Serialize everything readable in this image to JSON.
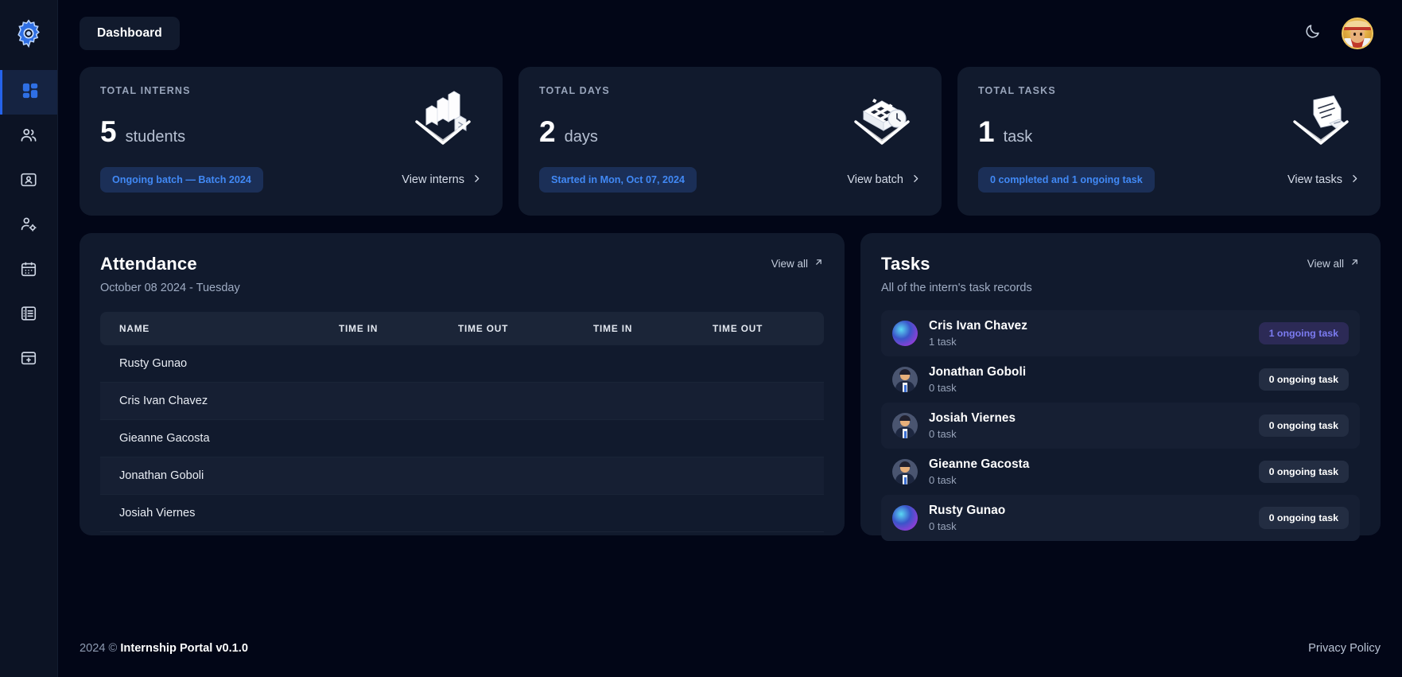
{
  "brand": {
    "icon": "gear-logo-icon"
  },
  "sidebar": {
    "items": [
      {
        "icon": "dashboard-grid-icon",
        "name": "dashboard",
        "active": true
      },
      {
        "icon": "users-icon",
        "name": "interns",
        "active": false
      },
      {
        "icon": "id-card-icon",
        "name": "profiles",
        "active": false
      },
      {
        "icon": "user-settings-icon",
        "name": "user-settings",
        "active": false
      },
      {
        "icon": "calendar-icon",
        "name": "calendar",
        "active": false
      },
      {
        "icon": "list-icon",
        "name": "records",
        "active": false
      },
      {
        "icon": "archive-box-icon",
        "name": "archive",
        "active": false
      }
    ]
  },
  "topbar": {
    "tab_label": "Dashboard",
    "theme_toggle_icon": "moon-icon",
    "avatar_alt": "user-avatar"
  },
  "stats": [
    {
      "label": "TOTAL INTERNS",
      "number": "5",
      "unit": "students",
      "chip": "Ongoing batch — Batch 2024",
      "link": "View interns",
      "art": "bar-chart-3d-icon"
    },
    {
      "label": "TOTAL DAYS",
      "number": "2",
      "unit": "days",
      "chip": "Started in Mon, Oct 07, 2024",
      "link": "View batch",
      "art": "calendar-clock-3d-icon"
    },
    {
      "label": "TOTAL TASKS",
      "number": "1",
      "unit": "task",
      "chip": "0 completed and 1 ongoing task",
      "link": "View tasks",
      "art": "document-3d-icon"
    }
  ],
  "attendance": {
    "title": "Attendance",
    "subtitle": "October 08 2024 - Tuesday",
    "view_all": "View all",
    "columns": [
      "NAME",
      "TIME IN",
      "TIME OUT",
      "TIME IN",
      "TIME OUT"
    ],
    "rows": [
      {
        "name": "Rusty Gunao",
        "time_in_1": "",
        "time_out_1": "",
        "time_in_2": "",
        "time_out_2": ""
      },
      {
        "name": "Cris Ivan Chavez",
        "time_in_1": "",
        "time_out_1": "",
        "time_in_2": "",
        "time_out_2": ""
      },
      {
        "name": "Gieanne Gacosta",
        "time_in_1": "",
        "time_out_1": "",
        "time_in_2": "",
        "time_out_2": ""
      },
      {
        "name": "Jonathan Goboli",
        "time_in_1": "",
        "time_out_1": "",
        "time_in_2": "",
        "time_out_2": ""
      },
      {
        "name": "Josiah Viernes",
        "time_in_1": "",
        "time_out_1": "",
        "time_in_2": "",
        "time_out_2": ""
      }
    ]
  },
  "tasks": {
    "title": "Tasks",
    "subtitle": "All of the intern's task records",
    "view_all": "View all",
    "rows": [
      {
        "name": "Cris Ivan Chavez",
        "count": "1 task",
        "badge": "1 ongoing task",
        "badge_style": "ongoing",
        "avatar": "planet-avatar"
      },
      {
        "name": "Jonathan Goboli",
        "count": "0 task",
        "badge": "0 ongoing task",
        "badge_style": "none",
        "avatar": "person-avatar"
      },
      {
        "name": "Josiah Viernes",
        "count": "0 task",
        "badge": "0 ongoing task",
        "badge_style": "none",
        "avatar": "person-avatar"
      },
      {
        "name": "Gieanne Gacosta",
        "count": "0 task",
        "badge": "0 ongoing task",
        "badge_style": "none",
        "avatar": "person-avatar"
      },
      {
        "name": "Rusty Gunao",
        "count": "0 task",
        "badge": "0 ongoing task",
        "badge_style": "none",
        "avatar": "planet-avatar"
      }
    ]
  },
  "footer": {
    "year": "2024",
    "copyright_symbol": "©",
    "app_name": "Internship Portal v0.1.0",
    "privacy": "Privacy Policy"
  },
  "colors": {
    "page_bg": "#020617",
    "sidebar_bg": "#0c1324",
    "card_bg": "#111a2d",
    "accent_blue": "#4189f5",
    "chip_bg": "#1b2f57",
    "badge_purple_bg": "#2c2a56",
    "badge_purple_fg": "#7b7bf0",
    "active_nav_bg": "#152341"
  }
}
